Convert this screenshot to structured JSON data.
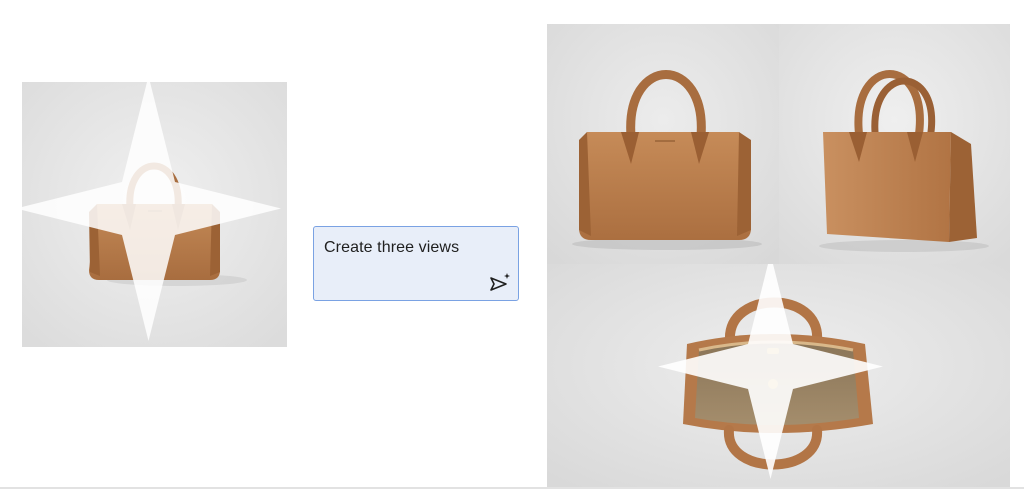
{
  "prompt": {
    "text": "Create three views",
    "send_icon": "send-sparkle-icon"
  },
  "input_image": {
    "subject": "tan leather top-handle handbag, front view",
    "watermark_icon": "sparkle-icon"
  },
  "output_images": [
    {
      "view": "front"
    },
    {
      "view": "three-quarter"
    },
    {
      "view": "top-open"
    }
  ],
  "colors": {
    "accent_border": "#7aa2e3",
    "prompt_bg": "#e8eef9",
    "leather": "#b5794a",
    "backdrop": "#e3e3e3"
  }
}
